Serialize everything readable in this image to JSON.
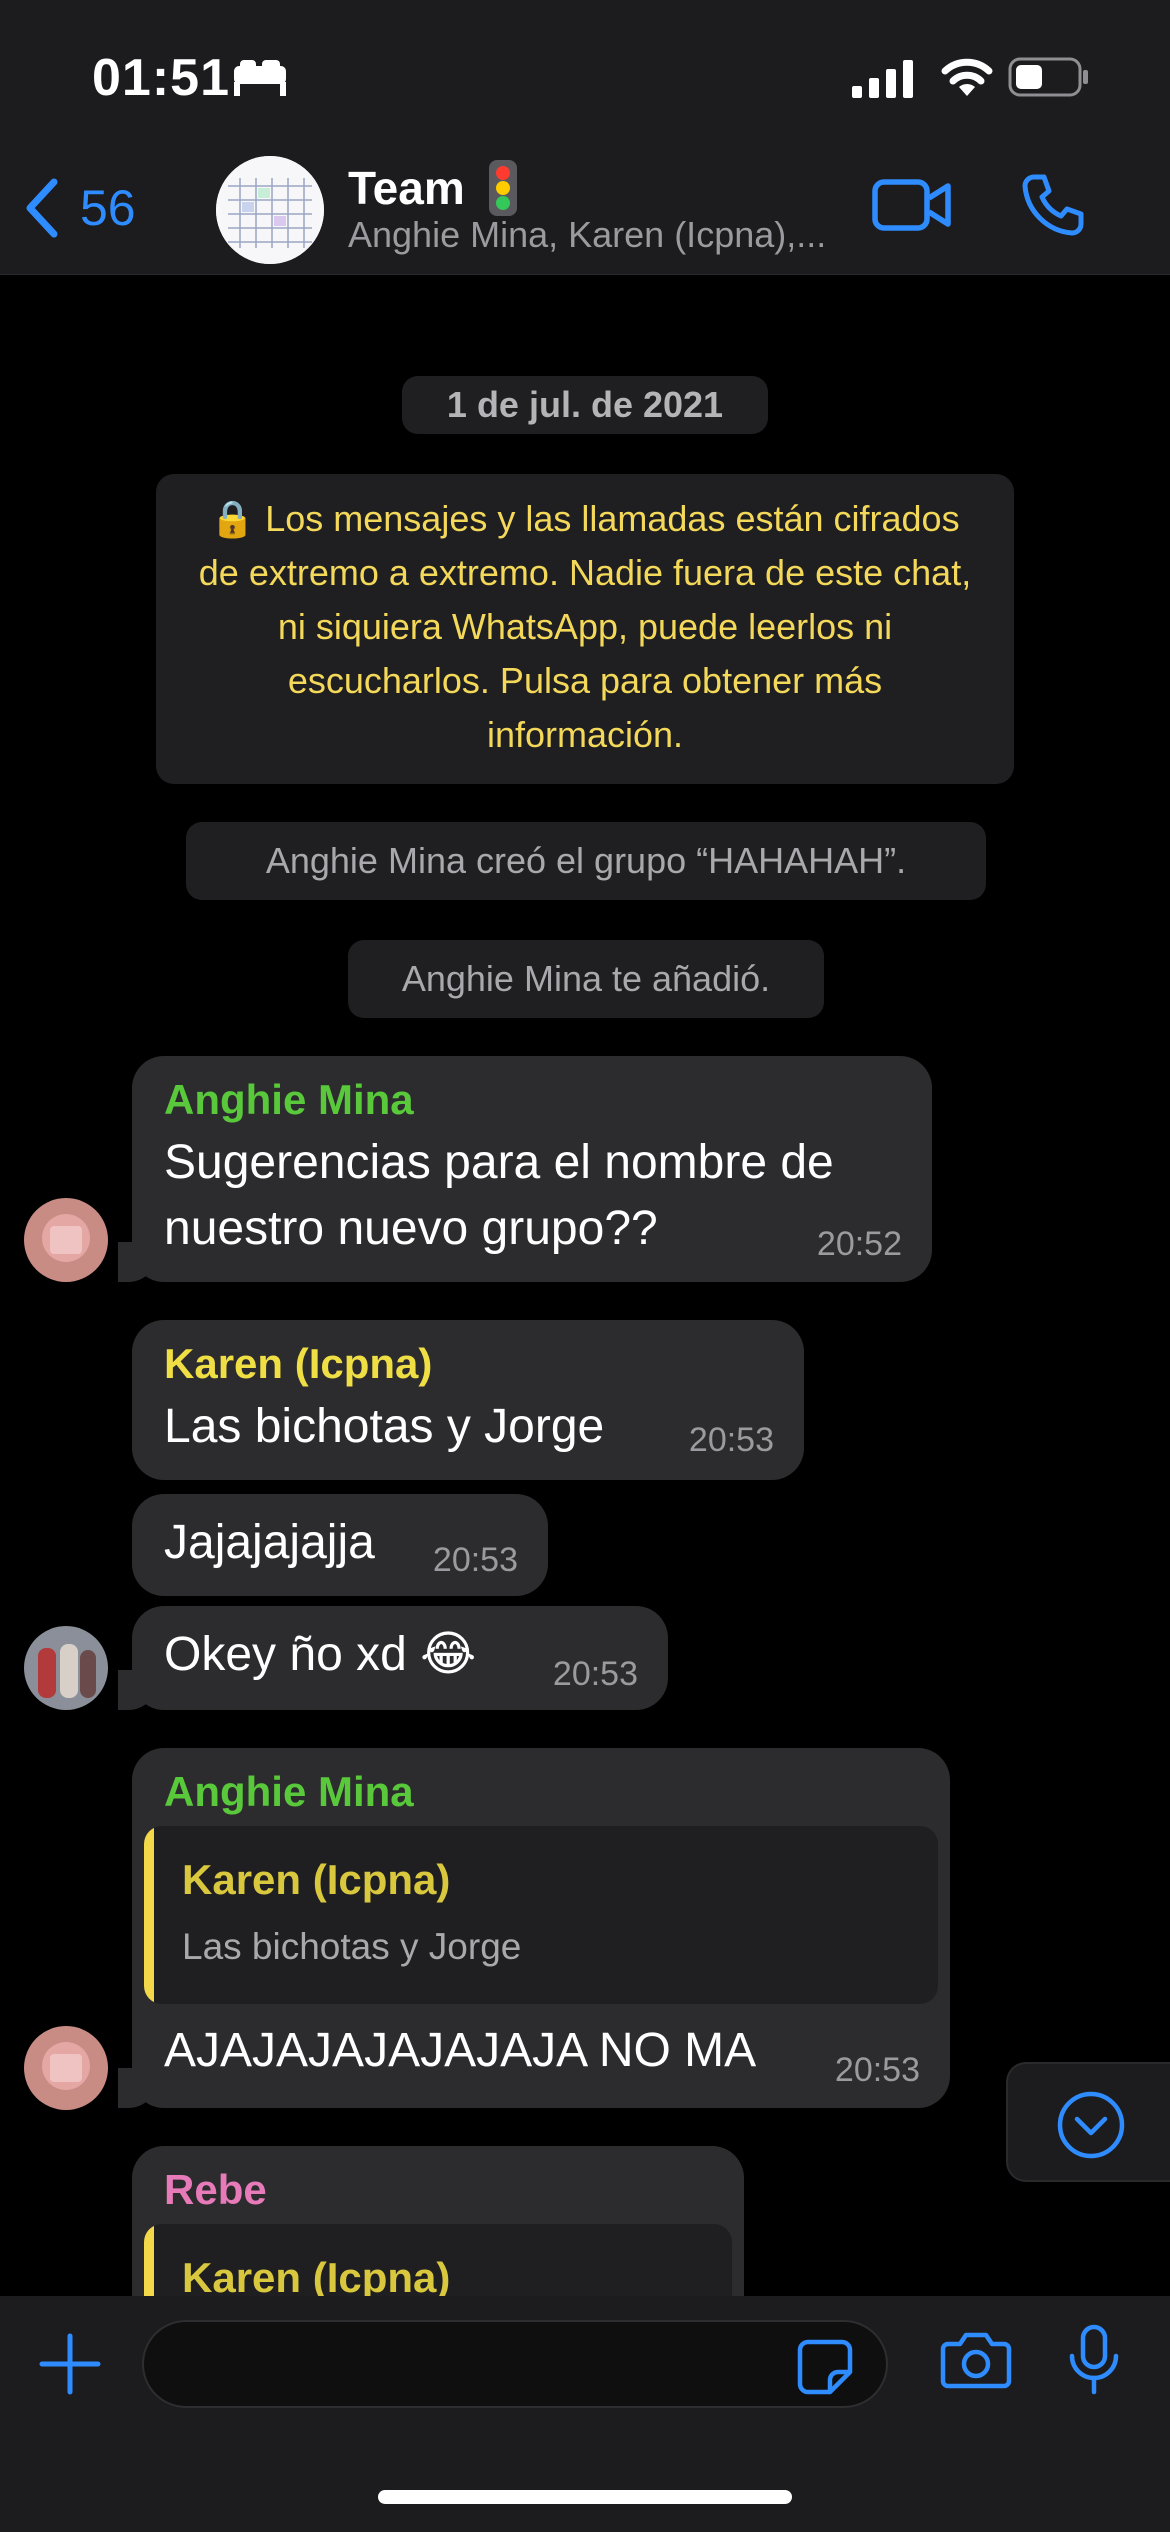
{
  "status_bar": {
    "time": "01:51"
  },
  "header": {
    "back_count": "56",
    "title": "Team",
    "subtitle": "Anghie Mina, Karen (Icpna),..."
  },
  "chat": {
    "date": "1 de jul. de 2021",
    "encryption_notice": "🔒 Los mensajes y las llamadas están cifrados de extremo a extremo. Nadie fuera de este chat, ni siquiera WhatsApp, puede leerlos ni escucharlos. Pulsa para obtener más información.",
    "system_messages": [
      "Anghie Mina creó el grupo “HAHAHAH”.",
      "Anghie Mina te añadió."
    ],
    "messages": [
      {
        "sender": "Anghie Mina",
        "sender_color": "#59c93b",
        "text": "Sugerencias para el nombre de nuestro nuevo grupo??",
        "time": "20:52"
      },
      {
        "sender": "Karen (Icpna)",
        "sender_color": "#f0df44",
        "text": "Las bichotas y Jorge",
        "time": "20:53"
      },
      {
        "sender": "",
        "text": "Jajajajajja",
        "time": "20:53"
      },
      {
        "sender": "",
        "text": "Okey ño xd 😂",
        "time": "20:53"
      },
      {
        "sender": "Anghie Mina",
        "sender_color": "#59c93b",
        "quote_sender": "Karen (Icpna)",
        "quote_text": "Las bichotas y Jorge",
        "text": "AJAJAJAJAJAJAJA NO MA",
        "time": "20:53"
      },
      {
        "sender": "Rebe",
        "sender_color": "#e77ab8",
        "quote_sender": "Karen (Icpna)"
      }
    ]
  },
  "input": {
    "placeholder": ""
  },
  "colors": {
    "accent": "#2f8cff",
    "bubble": "#2c2c2e",
    "notice_text": "#f3d85a"
  }
}
